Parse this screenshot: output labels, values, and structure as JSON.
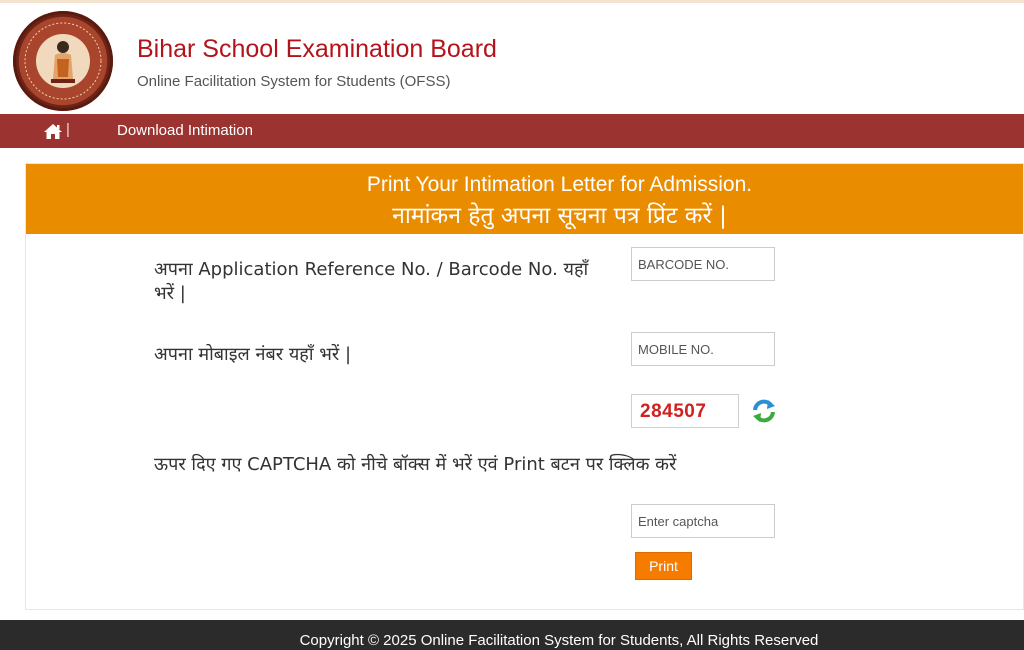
{
  "header": {
    "title": "Bihar School Examination Board",
    "subtitle": "Online Facilitation System for Students (OFSS)",
    "logo_icon": "bseb-emblem-logo"
  },
  "nav": {
    "home_icon": "home-icon",
    "separator": "|",
    "items": [
      {
        "label": "Download Intimation"
      }
    ]
  },
  "panel": {
    "heading_en": "Print Your Intimation Letter for Admission.",
    "heading_hi": "नामांकन हेतु अपना सूचना पत्र प्रिंट करें |"
  },
  "form": {
    "barcode_label": "अपना Application Reference No. / Barcode No. यहाँ भरें |",
    "barcode_placeholder": "BARCODE NO.",
    "mobile_label": "अपना मोबाइल नंबर यहाँ भरें |",
    "mobile_placeholder": "MOBILE NO.",
    "captcha_value": "284507",
    "refresh_icon": "refresh-icon",
    "captcha_instruction": "ऊपर दिए गए CAPTCHA को नीचे बॉक्स में भरें एवं Print बटन पर क्लिक करें",
    "captcha_placeholder": "Enter captcha",
    "print_label": "Print"
  },
  "footer": {
    "copyright": "Copyright © 2025 Online Facilitation System for Students, All Rights Reserved"
  },
  "colors": {
    "title_red": "#b3141b",
    "nav_maroon": "#9b3331",
    "panel_orange": "#ea8c00",
    "button_orange": "#f57c00",
    "captcha_red": "#d21f1f",
    "footer_dark": "#2b2b2b"
  }
}
